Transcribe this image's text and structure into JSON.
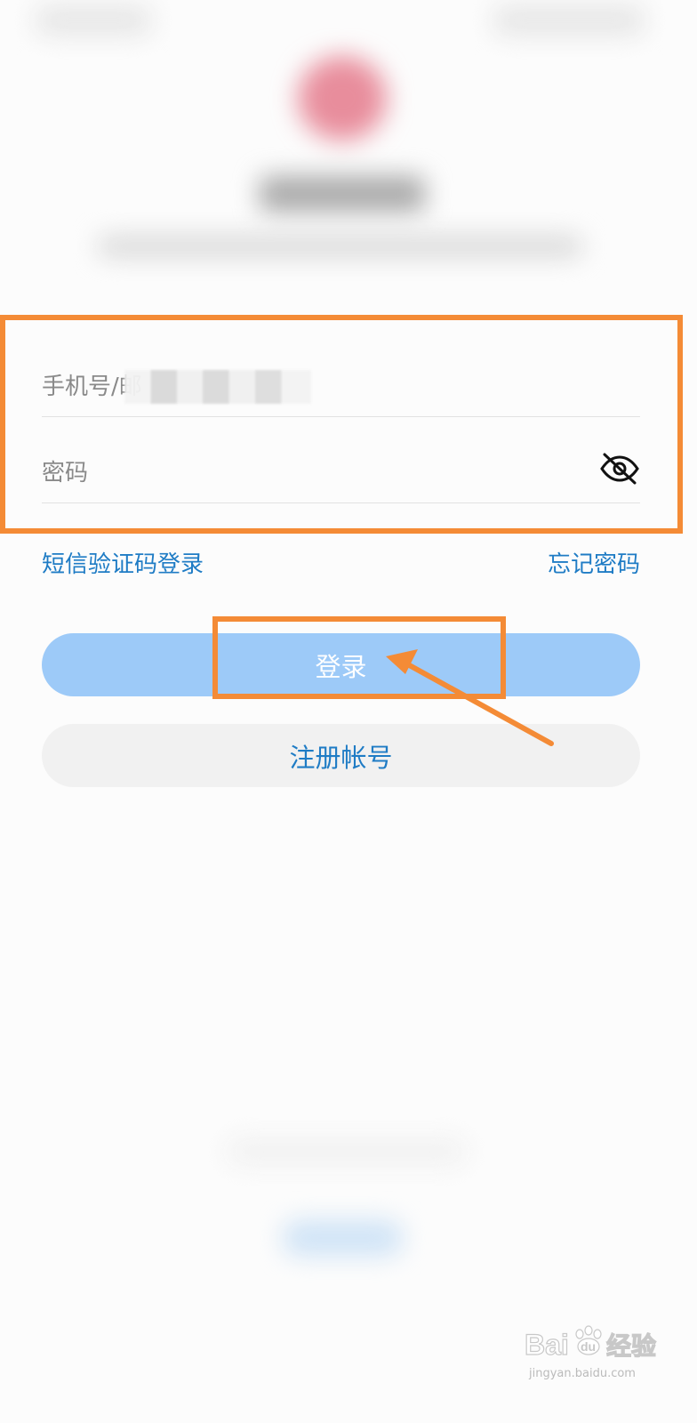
{
  "login_form": {
    "phone_placeholder": "手机号/邮",
    "password_placeholder": "密码",
    "password_visibility_icon": "eye-off-icon"
  },
  "links": {
    "sms_login": "短信验证码登录",
    "forgot_password": "忘记密码"
  },
  "buttons": {
    "login": "登录",
    "register": "注册帐号"
  },
  "colors": {
    "annotation": "#f48b36",
    "link": "#1f7cc5",
    "login_button": "#9dcaf8",
    "register_button": "#f1f1f1"
  },
  "watermark": {
    "brand": "Baidu经验",
    "url": "jingyan.baidu.com"
  }
}
